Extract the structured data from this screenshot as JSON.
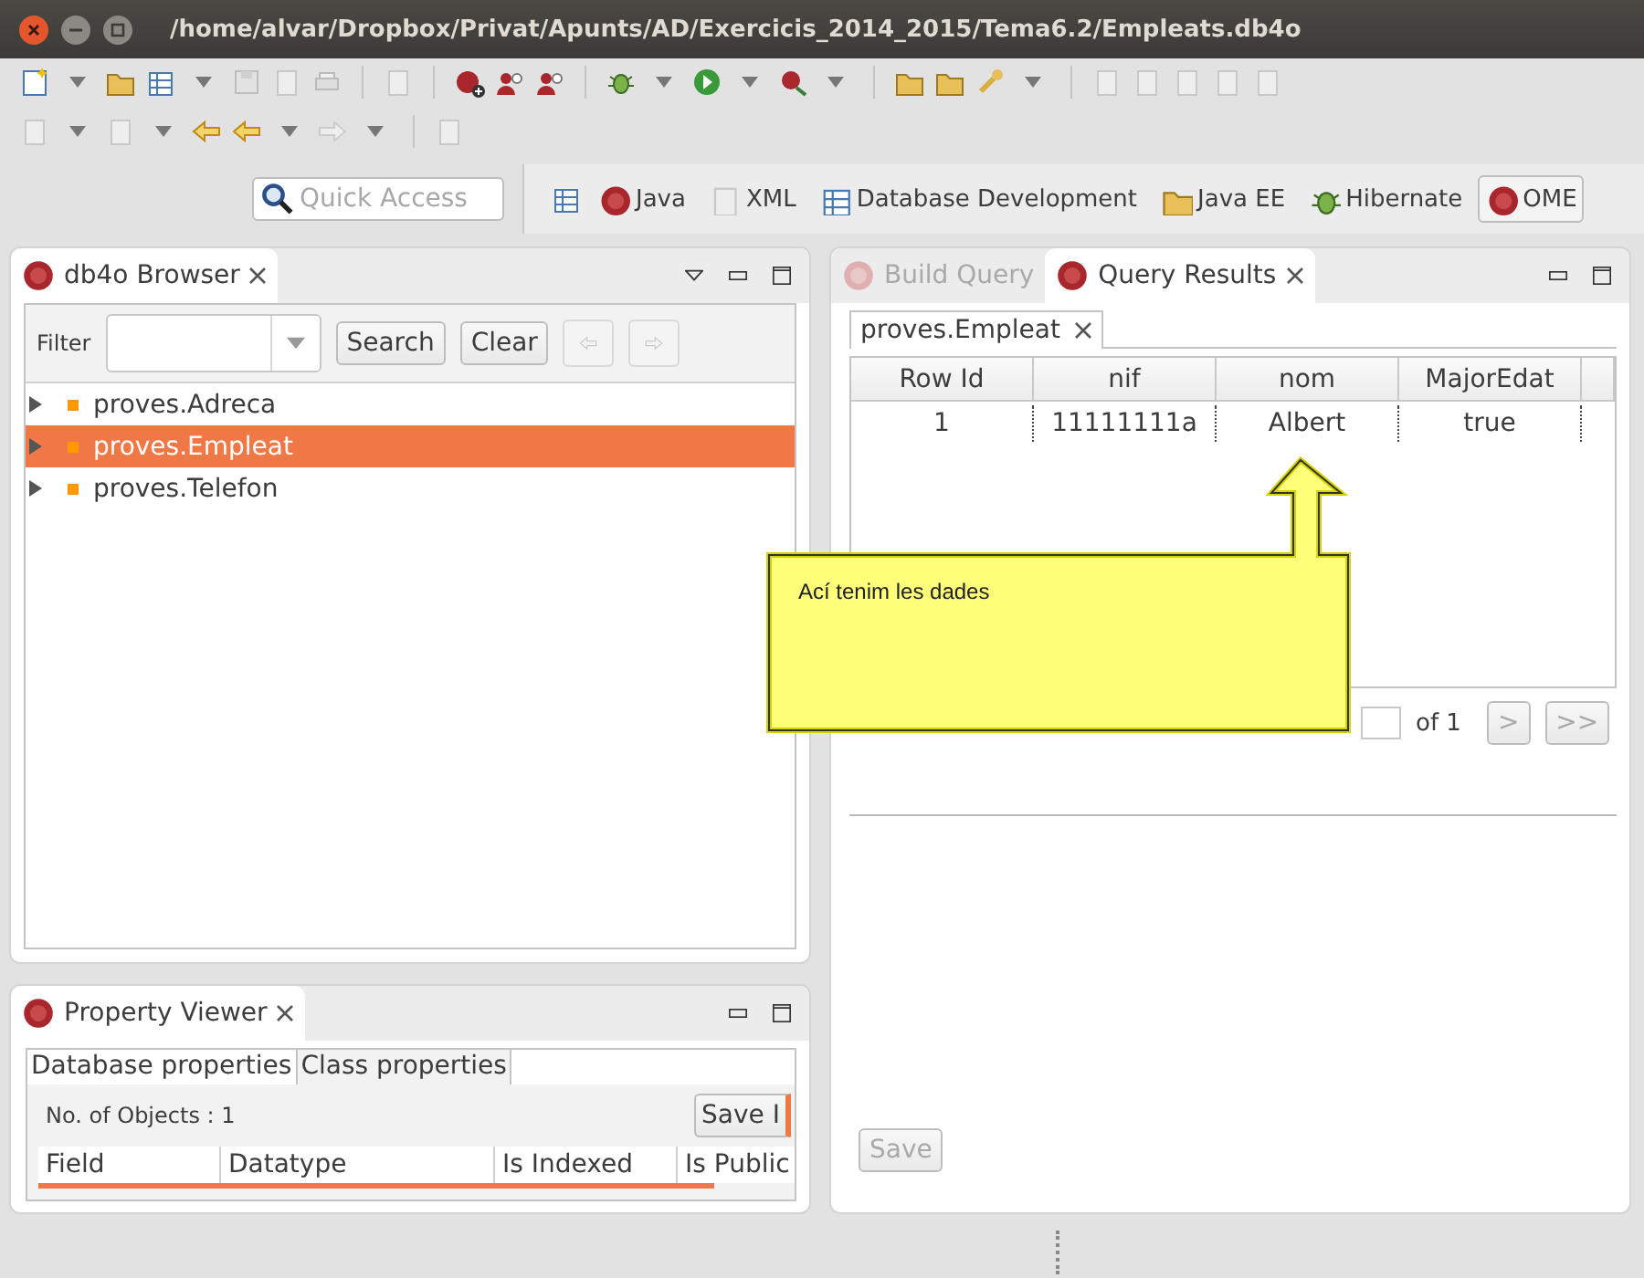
{
  "window": {
    "title": "/home/alvar/Dropbox/Privat/Apunts/AD/Exercicis_2014_2015/Tema6.2/Empleats.db4o"
  },
  "quick_access": {
    "placeholder": "Quick Access"
  },
  "perspectives": [
    {
      "label": "Java",
      "selected": false
    },
    {
      "label": "XML",
      "selected": false
    },
    {
      "label": "Database Development",
      "selected": false
    },
    {
      "label": "Java EE",
      "selected": false
    },
    {
      "label": "Hibernate",
      "selected": false
    },
    {
      "label": "OME",
      "selected": true
    }
  ],
  "browser": {
    "title": "db4o Browser",
    "filter_label": "Filter",
    "buttons": [
      "Search",
      "Clear"
    ],
    "items": [
      {
        "label": "proves.Adreca",
        "selected": false
      },
      {
        "label": "proves.Empleat",
        "selected": true
      },
      {
        "label": "proves.Telefon",
        "selected": false
      }
    ]
  },
  "query": {
    "tabs": [
      {
        "label": "Build Query",
        "selected": false
      },
      {
        "label": "Query Results",
        "selected": true
      }
    ],
    "result_tab": "proves.Empleat",
    "columns": [
      "Row Id",
      "nif",
      "nom",
      "MajorEdat"
    ],
    "rows": [
      [
        "1",
        "11111111a",
        "Albert",
        "true"
      ]
    ],
    "pager": {
      "of_label": "of 1",
      "buttons": [
        ">",
        ">>"
      ]
    },
    "save": {
      "label": "Save",
      "disabled": true
    },
    "callout": "Ací tenim les dades"
  },
  "properties": {
    "title": "Property Viewer",
    "tabs": [
      {
        "label": "Database properties",
        "selected": false
      },
      {
        "label": "Class properties",
        "selected": true
      }
    ],
    "objects_label": "No. of Objects : 1",
    "save": {
      "label": "Save I",
      "disabled": false
    },
    "columns": [
      "Field",
      "Datatype",
      "Is Indexed",
      "Is Public"
    ]
  }
}
